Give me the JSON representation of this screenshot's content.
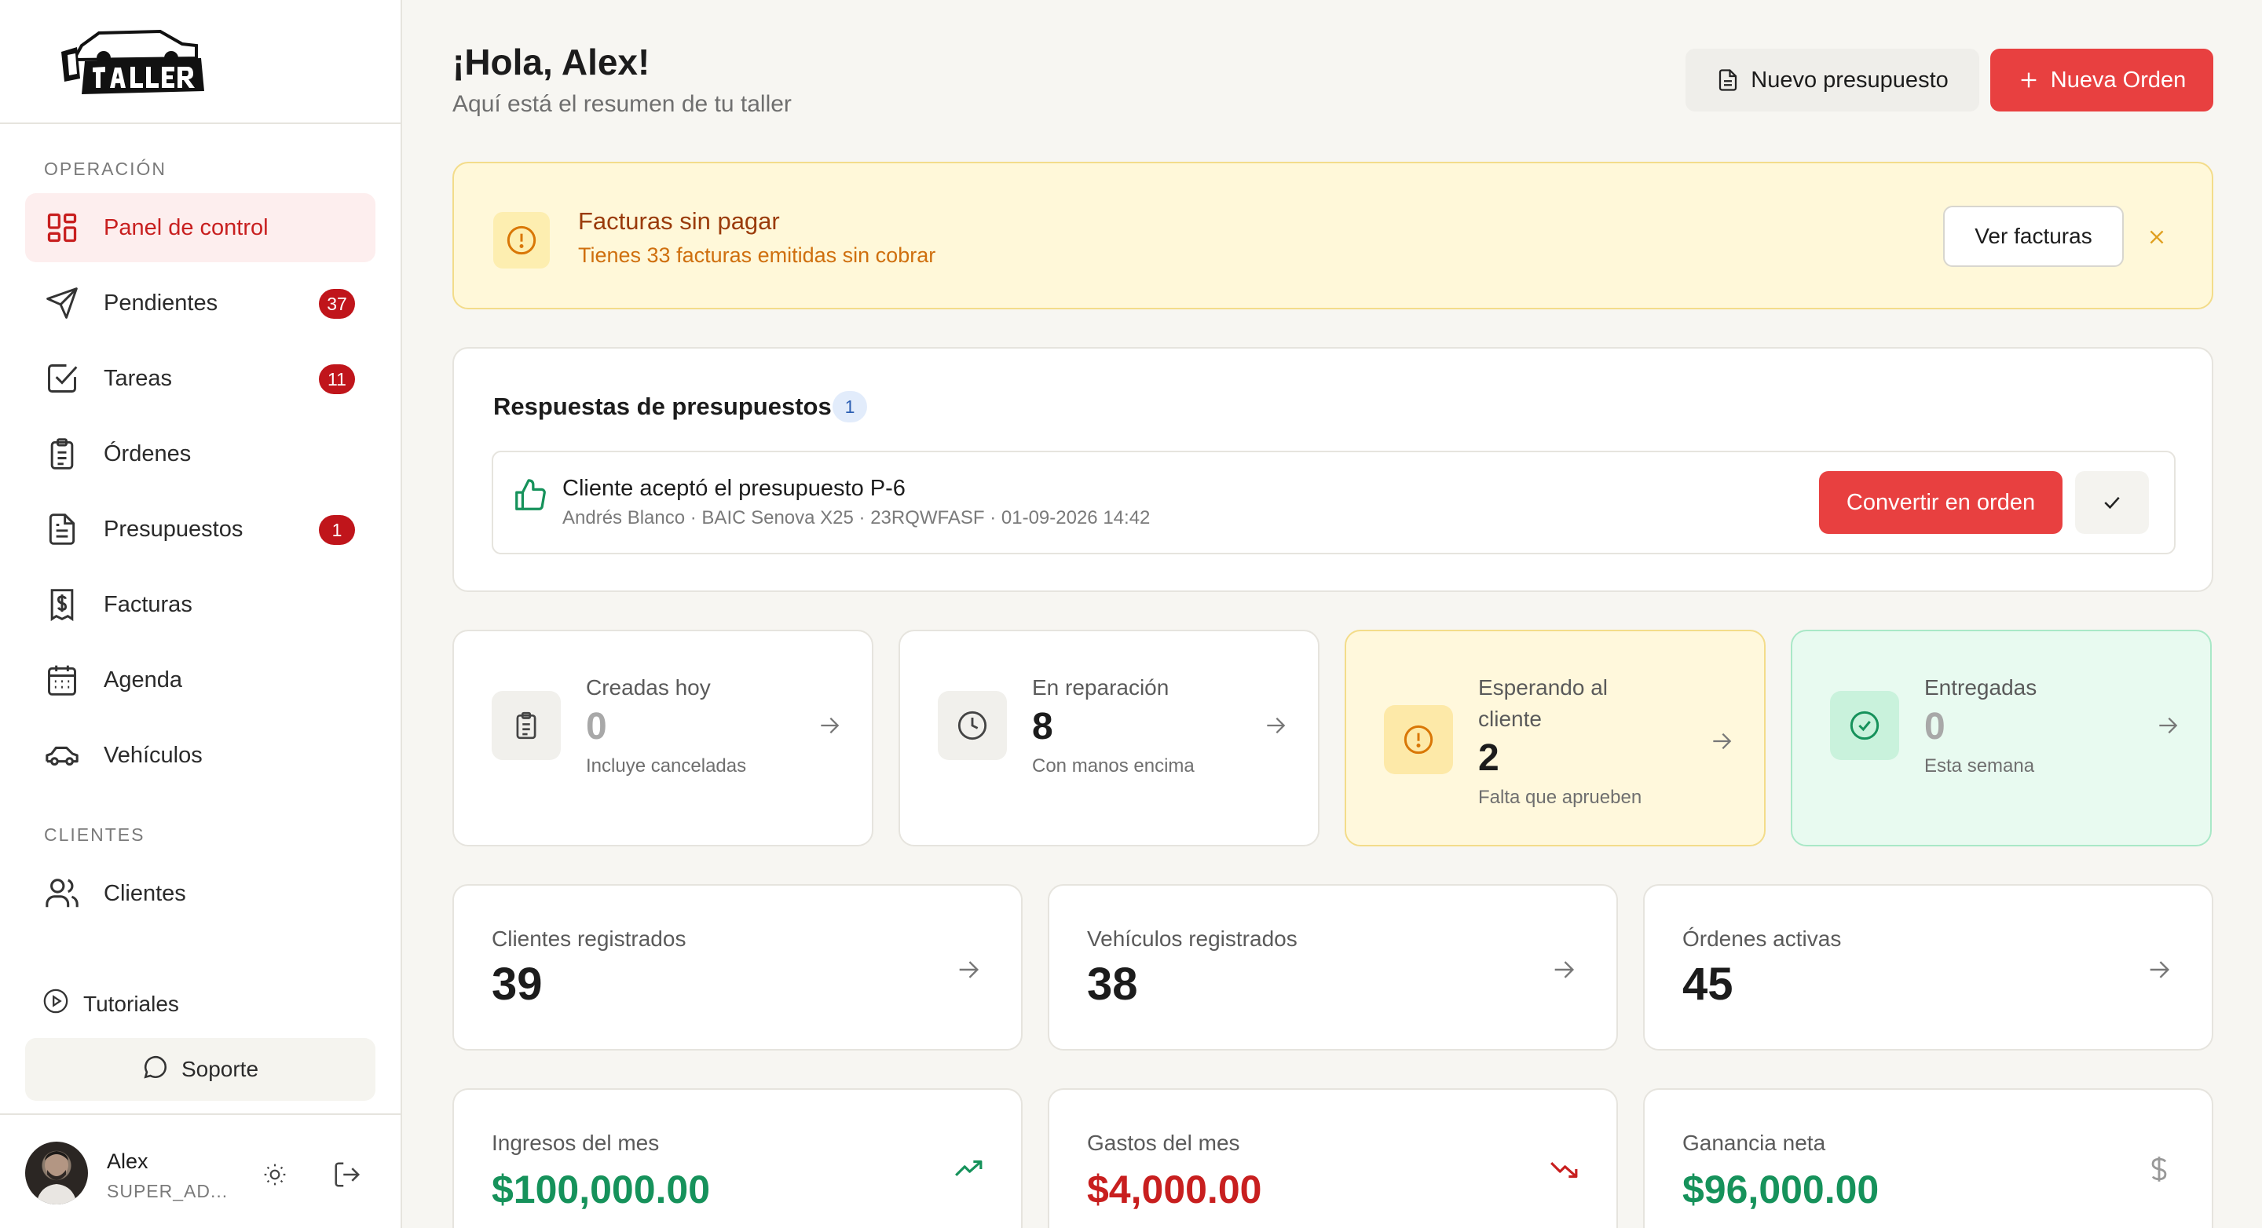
{
  "sidebar": {
    "logo_alt": "mi taller",
    "sections": {
      "operacion": "OPERACIÓN",
      "clientes": "CLIENTES"
    },
    "items": [
      {
        "label": "Panel de control",
        "badge": ""
      },
      {
        "label": "Pendientes",
        "badge": "37"
      },
      {
        "label": "Tareas",
        "badge": "11"
      },
      {
        "label": "Órdenes",
        "badge": ""
      },
      {
        "label": "Presupuestos",
        "badge": "1"
      },
      {
        "label": "Facturas",
        "badge": ""
      },
      {
        "label": "Agenda",
        "badge": ""
      },
      {
        "label": "Vehículos",
        "badge": ""
      },
      {
        "label": "Clientes",
        "badge": ""
      }
    ],
    "tutoriales": "Tutoriales",
    "soporte": "Soporte",
    "user": {
      "name": "Alex",
      "role": "SUPER_AD..."
    }
  },
  "header": {
    "greeting": "¡Hola, Alex!",
    "subtitle": "Aquí está el resumen de tu taller",
    "new_quote": "Nuevo presupuesto",
    "new_order": "Nueva Orden"
  },
  "alert": {
    "title": "Facturas sin pagar",
    "text": "Tienes 33 facturas emitidas sin cobrar",
    "button": "Ver facturas"
  },
  "responses": {
    "title": "Respuestas de presupuestos",
    "count": "1",
    "item": {
      "title": "Cliente aceptó el presupuesto P-6",
      "meta": "Andrés Blanco · BAIC Senova X25 · 23RQWFASF · 01-09-2026 14:42",
      "convert": "Convertir en orden"
    }
  },
  "stats": [
    {
      "label": "Creadas hoy",
      "value": "0",
      "sub": "Incluye canceladas"
    },
    {
      "label": "En reparación",
      "value": "8",
      "sub": "Con manos encima"
    },
    {
      "label": "Esperando al cliente",
      "value": "2",
      "sub": "Falta que aprueben"
    },
    {
      "label": "Entregadas",
      "value": "0",
      "sub": "Esta semana"
    }
  ],
  "totals": [
    {
      "label": "Clientes registrados",
      "value": "39"
    },
    {
      "label": "Vehículos registrados",
      "value": "38"
    },
    {
      "label": "Órdenes activas",
      "value": "45"
    }
  ],
  "finance": [
    {
      "label": "Ingresos del mes",
      "value": "$100,000.00"
    },
    {
      "label": "Gastos del mes",
      "value": "$4,000.00"
    },
    {
      "label": "Ganancia neta",
      "value": "$96,000.00"
    }
  ],
  "colors": {
    "accent": "#e84040",
    "income": "#16925b",
    "expense": "#c81f1f",
    "warning": "#cf6f0e"
  }
}
